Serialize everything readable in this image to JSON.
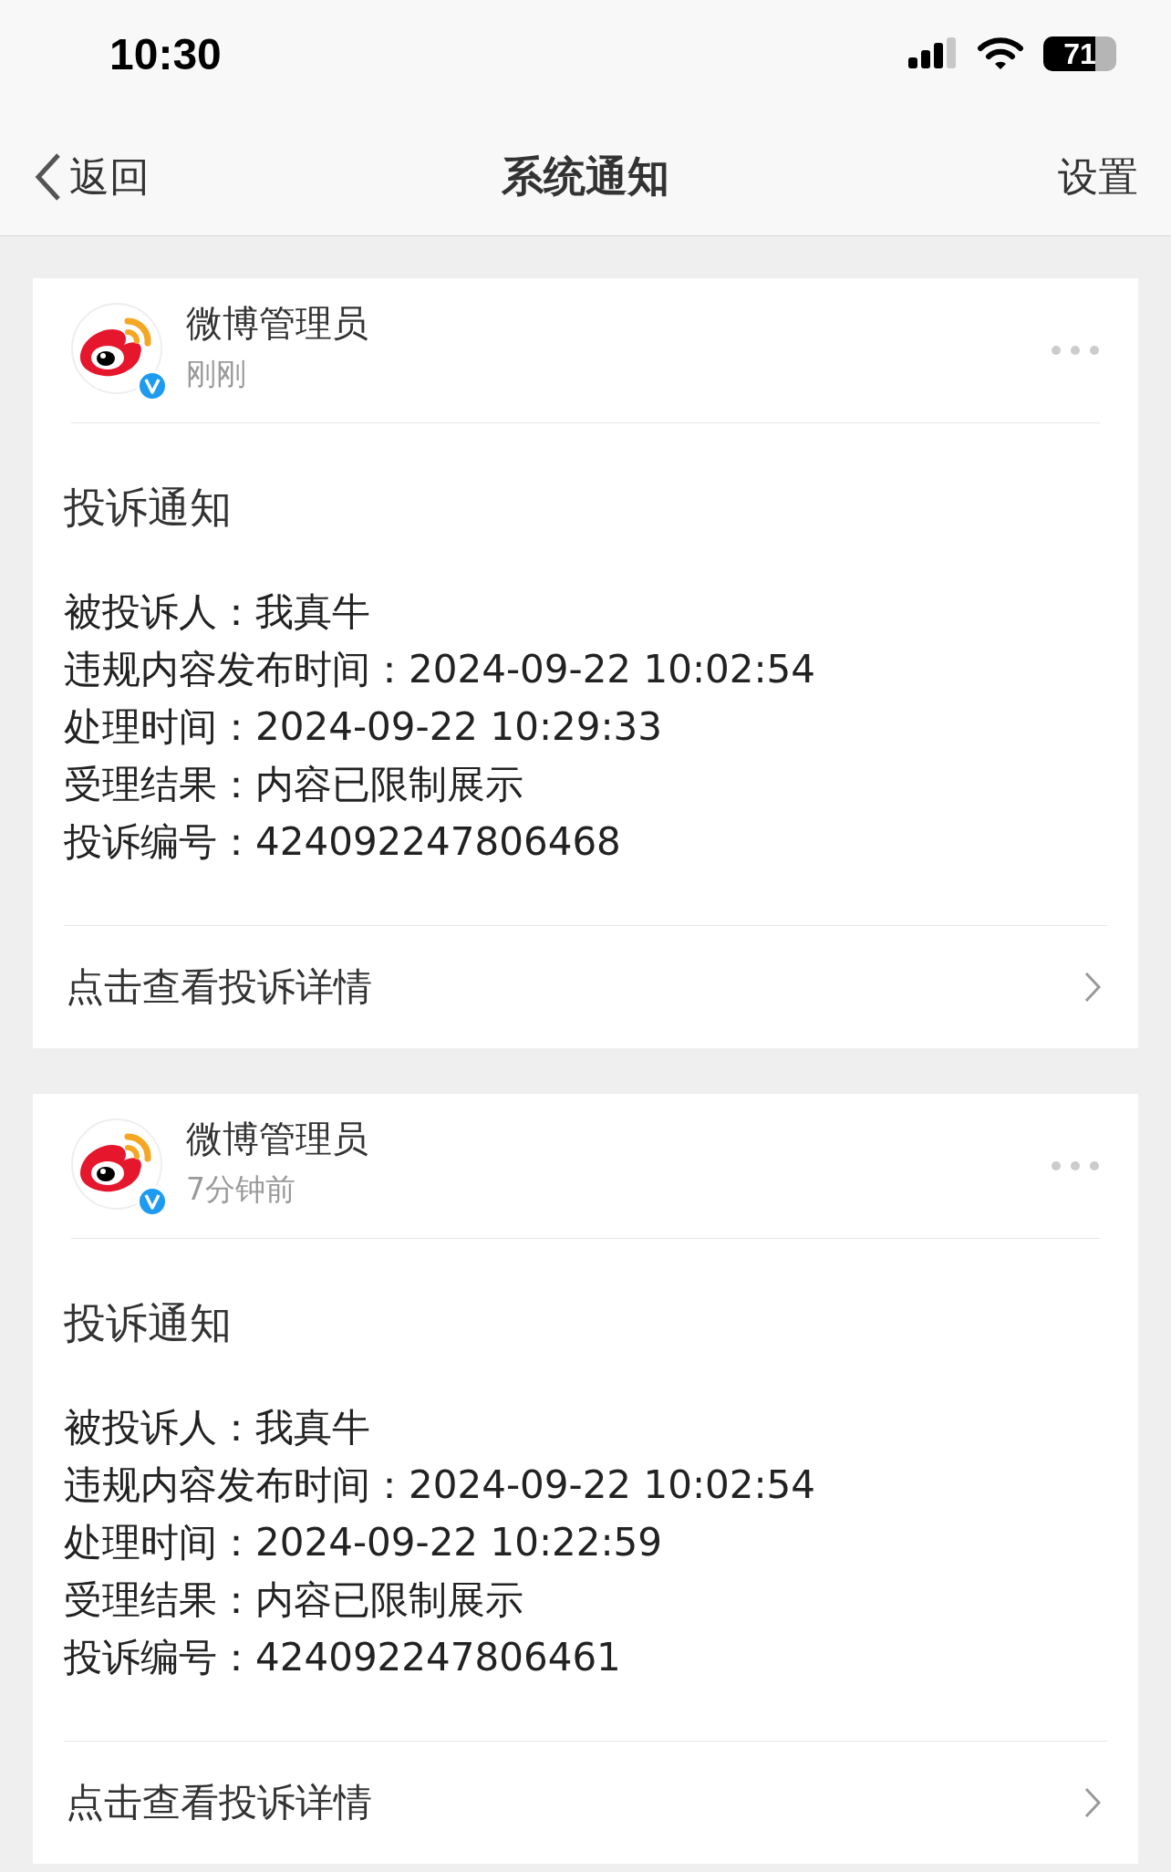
{
  "status_bar": {
    "time": "10:30",
    "battery": "71"
  },
  "nav": {
    "back": "返回",
    "title": "系统通知",
    "action": "设置"
  },
  "notifications": [
    {
      "sender": "微博管理员",
      "time": "刚刚",
      "title": "投诉通知",
      "fields": [
        {
          "label": "被投诉人：",
          "value": "我真牛"
        },
        {
          "label": "违规内容发布时间：",
          "value": "2024-09-22 10:02:54"
        },
        {
          "label": "处理时间：",
          "value": "2024-09-22 10:29:33"
        },
        {
          "label": "受理结果：",
          "value": "内容已限制展示"
        },
        {
          "label": "投诉编号：",
          "value": "424092247806468"
        }
      ],
      "link": "点击查看投诉详情"
    },
    {
      "sender": "微博管理员",
      "time": "7分钟前",
      "title": "投诉通知",
      "fields": [
        {
          "label": "被投诉人：",
          "value": "我真牛"
        },
        {
          "label": "违规内容发布时间：",
          "value": "2024-09-22 10:02:54"
        },
        {
          "label": "处理时间：",
          "value": "2024-09-22 10:22:59"
        },
        {
          "label": "受理结果：",
          "value": "内容已限制展示"
        },
        {
          "label": "投诉编号：",
          "value": "424092247806461"
        }
      ],
      "link": "点击查看投诉详情"
    }
  ]
}
